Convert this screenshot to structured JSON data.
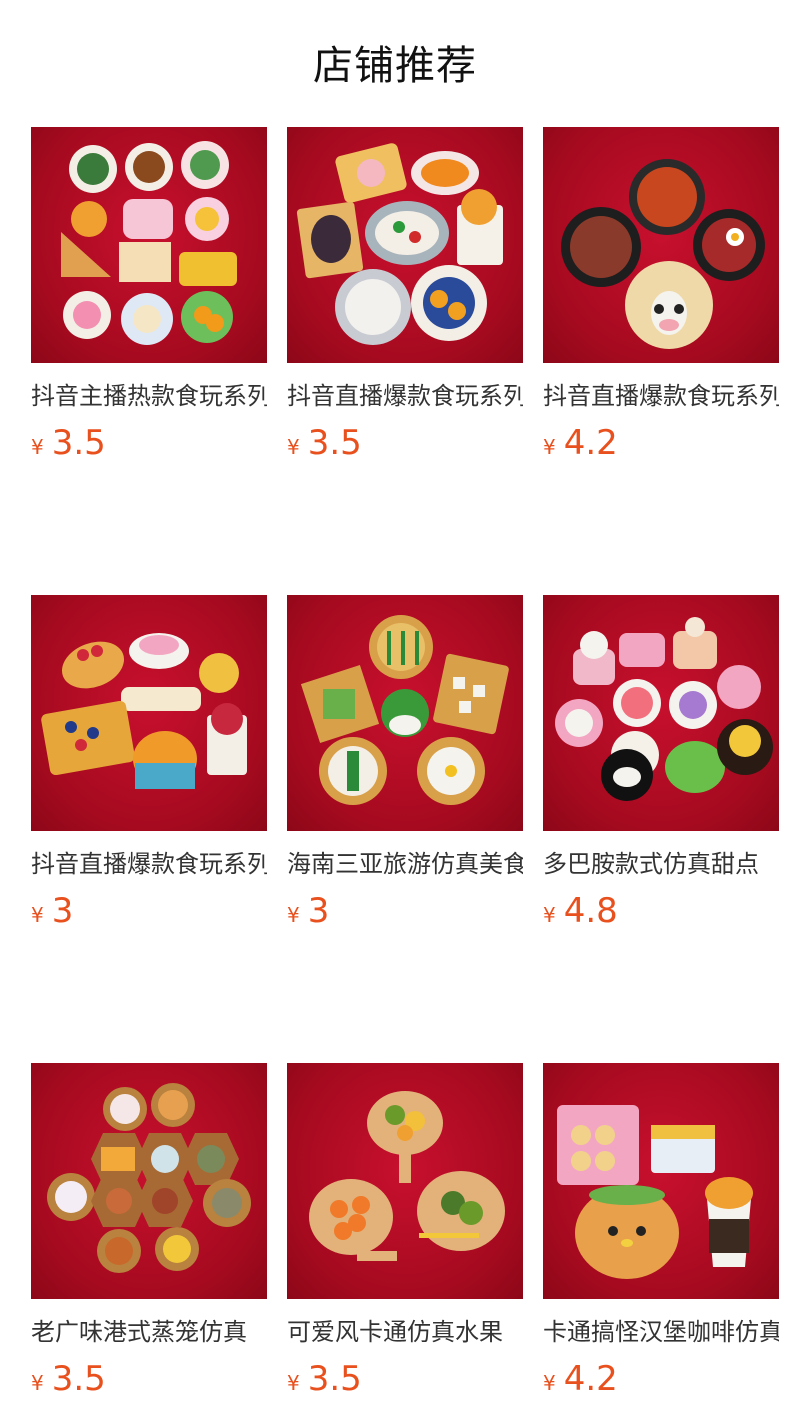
{
  "header": {
    "title": "店铺推荐"
  },
  "colors": {
    "price": "#e8501e",
    "photo_background": "#b50c22"
  },
  "products": [
    {
      "name": "抖音主播热款食玩系列",
      "currency": "¥",
      "price": "3.5",
      "image": "food-plates-photo"
    },
    {
      "name": "抖音直播爆款食玩系列",
      "currency": "¥",
      "price": "3.5",
      "image": "dim-sum-dishes-photo"
    },
    {
      "name": "抖音直播爆款食玩系列",
      "currency": "¥",
      "price": "4.2",
      "image": "clay-pot-dishes-photo"
    },
    {
      "name": "抖音直播爆款食玩系列",
      "currency": "¥",
      "price": "3",
      "image": "waffle-desserts-photo"
    },
    {
      "name": "海南三亚旅游仿真美食",
      "currency": "¥",
      "price": "3",
      "image": "hainan-snacks-photo"
    },
    {
      "name": "多巴胺款式仿真甜点",
      "currency": "¥",
      "price": "4.8",
      "image": "cakes-photo"
    },
    {
      "name": "老广味港式蒸笼仿真",
      "currency": "¥",
      "price": "3.5",
      "image": "dim-sum-baskets-photo"
    },
    {
      "name": "可爱风卡通仿真水果",
      "currency": "¥",
      "price": "3.5",
      "image": "fruit-boards-photo"
    },
    {
      "name": "卡通搞怪汉堡咖啡仿真",
      "currency": "¥",
      "price": "4.2",
      "image": "burger-coffee-photo"
    }
  ]
}
